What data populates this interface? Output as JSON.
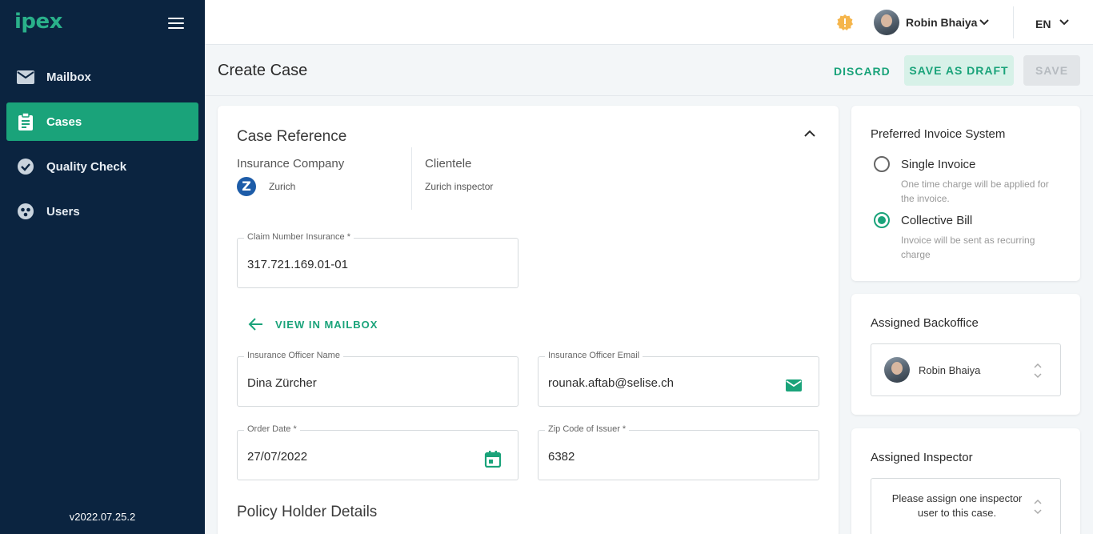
{
  "app": {
    "logo": "ipex",
    "version": "v2022.07.25.2"
  },
  "sidebar": {
    "items": [
      {
        "label": "Mailbox",
        "icon": "mail-icon",
        "active": false
      },
      {
        "label": "Cases",
        "icon": "clipboard-icon",
        "active": true
      },
      {
        "label": "Quality Check",
        "icon": "check-circle-icon",
        "active": false
      },
      {
        "label": "Users",
        "icon": "users-icon",
        "active": false
      }
    ]
  },
  "topbar": {
    "user_name": "Robin Bhaiya",
    "language": "EN"
  },
  "header": {
    "title": "Create Case",
    "discard_label": "DISCARD",
    "save_draft_label": "SAVE AS DRAFT",
    "save_label": "SAVE"
  },
  "case_reference": {
    "title": "Case Reference",
    "insurance_company_label": "Insurance Company",
    "insurance_company_value": "Zurich",
    "insurance_logo_letter": "Z",
    "clientele_label": "Clientele",
    "clientele_value": "Zurich inspector",
    "claim_number": {
      "label": "Claim Number Insurance *",
      "value": "317.721.169.01-01"
    },
    "view_mailbox_label": "VIEW IN MAILBOX",
    "officer_name": {
      "label": "Insurance Officer Name",
      "value": "Dina Zürcher"
    },
    "officer_email": {
      "label": "Insurance Officer Email",
      "value": "rounak.aftab@selise.ch"
    },
    "order_date": {
      "label": "Order Date *",
      "value": "27/07/2022"
    },
    "zip_code": {
      "label": "Zip Code of Issuer *",
      "value": "6382"
    }
  },
  "policy_holder": {
    "title": "Policy Holder Details"
  },
  "invoice_system": {
    "title": "Preferred Invoice System",
    "options": [
      {
        "label": "Single Invoice",
        "description": "One time charge will be applied for the invoice.",
        "checked": false
      },
      {
        "label": "Collective Bill",
        "description": "Invoice will be sent as recurring charge",
        "checked": true
      }
    ]
  },
  "backoffice": {
    "title": "Assigned Backoffice",
    "value": "Robin Bhaiya"
  },
  "inspector": {
    "title": "Assigned Inspector",
    "placeholder": "Please assign one inspector user to this case."
  },
  "colors": {
    "accent": "#1aa37a",
    "sidebar": "#0b2440",
    "warning": "#f5a623"
  }
}
